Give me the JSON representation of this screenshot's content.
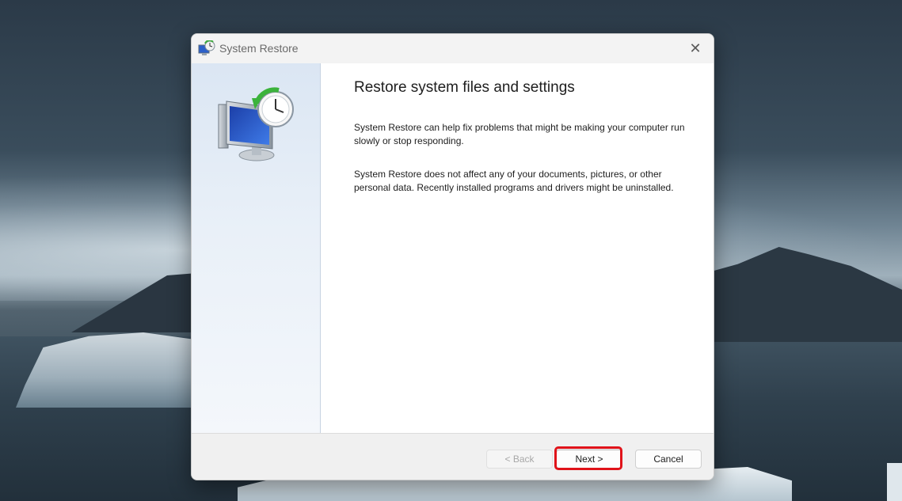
{
  "window": {
    "title": "System Restore",
    "icon": "system-restore-icon",
    "close_glyph": "✕"
  },
  "content": {
    "heading": "Restore system files and settings",
    "paragraph1": "System Restore can help fix problems that might be making your computer run slowly or stop responding.",
    "paragraph2": "System Restore does not affect any of your documents, pictures, or other personal data. Recently installed programs and drivers might be uninstalled."
  },
  "buttons": {
    "back": "< Back",
    "next": "Next >",
    "cancel": "Cancel"
  },
  "state": {
    "back_enabled": false,
    "highlighted_button": "next",
    "highlight_color": "#e0131a"
  }
}
